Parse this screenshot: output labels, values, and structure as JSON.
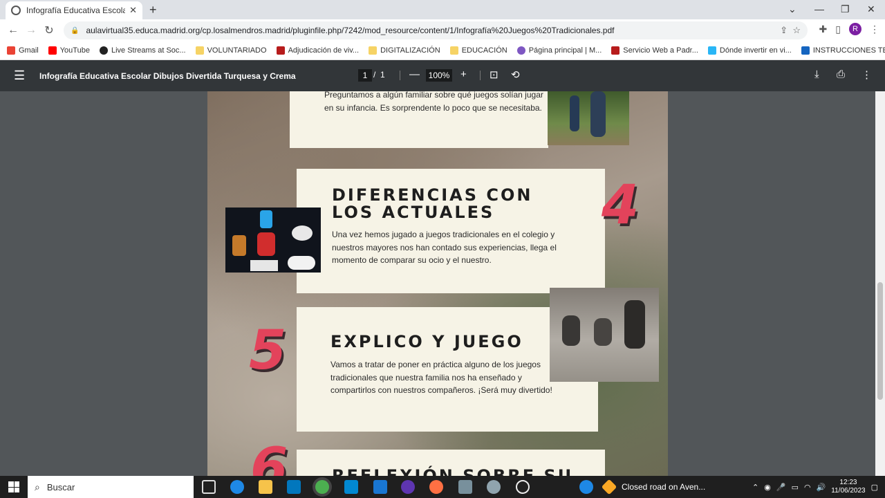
{
  "browser": {
    "tab_title": "Infografía Educativa Escolar Dibuj",
    "url": "aulavirtual35.educa.madrid.org/cp.losalmendros.madrid/pluginfile.php/7242/mod_resource/content/1/Infografía%20Juegos%20Tradicionales.pdf",
    "avatar_letter": "R"
  },
  "bookmarks": [
    {
      "label": "Gmail",
      "color": "#ea4335"
    },
    {
      "label": "YouTube",
      "color": "#ff0000"
    },
    {
      "label": "Live Streams at Soc...",
      "color": "#222222"
    },
    {
      "label": "VOLUNTARIADO",
      "color": "#f6d365"
    },
    {
      "label": "Adjudicación de viv...",
      "color": "#b71c1c"
    },
    {
      "label": "DIGITALIZACIÓN",
      "color": "#f6d365"
    },
    {
      "label": "EDUCACIÓN",
      "color": "#f6d365"
    },
    {
      "label": "Página principal | M...",
      "color": "#7e57c2"
    },
    {
      "label": "Servicio Web a Padr...",
      "color": "#b71c1c"
    },
    {
      "label": "Dónde invertir en vi...",
      "color": "#29b6f6"
    },
    {
      "label": "INSTRUCCIONES TE...",
      "color": "#1565c0"
    }
  ],
  "pdf": {
    "title": "Infografía Educativa Escolar Dibujos Divertida Turquesa y Crema",
    "page_current": "1",
    "page_sep": "/",
    "page_total": "1",
    "zoom": "100%"
  },
  "content": {
    "top_text": "Preguntamos a algún familiar sobre qué juegos solían jugar en su infancia. Es sorprendente lo poco que se necesitaba.",
    "section4": {
      "number": "4",
      "title": "DIFERENCIAS CON LOS ACTUALES",
      "text": "Una vez hemos jugado a juegos tradicionales en el colegio y nuestros mayores nos han contado sus experiencias, llega el momento de comparar su ocio y el nuestro."
    },
    "section5": {
      "number": "5",
      "title": "EXPLICO Y JUEGO",
      "text": "Vamos a tratar de poner en práctica alguno de los juegos tradicionales que nuestra familia nos ha enseñado y compartirlos con nuestros compañeros. ¡Será muy divertido!"
    },
    "section6": {
      "number": "6",
      "title": "REFLEXIÓN SOBRE SU"
    }
  },
  "taskbar": {
    "search_label": "Buscar",
    "notification": "Closed road on Aven...",
    "time": "12:23",
    "date": "11/06/2023"
  },
  "colors": {
    "accent_number": "#e3435b",
    "card_bg": "#f6f3e6",
    "toolbar_bg": "#323639"
  }
}
